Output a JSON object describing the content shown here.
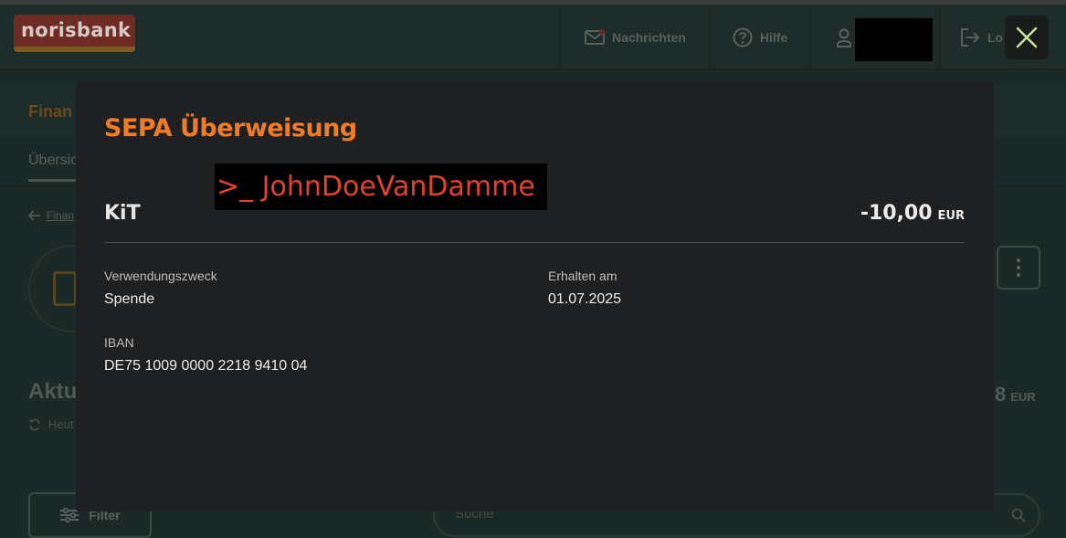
{
  "brand": {
    "logo_text": "norisbank"
  },
  "header": {
    "nav": [
      {
        "label": "Nachrichten",
        "icon": "mail-icon"
      },
      {
        "label": "Hilfe",
        "icon": "help-circle-icon"
      },
      {
        "label": "",
        "icon": "user-icon"
      },
      {
        "label": "Lo",
        "icon": "logout-icon"
      }
    ]
  },
  "background": {
    "section_title": "Finan",
    "tab_label": "Übersic",
    "back_link": "Finan",
    "balance_label": "Aktu",
    "updated_label": "Heut",
    "balance_value": "8",
    "balance_currency": "EUR",
    "filter_label": "Filter",
    "search_placeholder": "Suche"
  },
  "modal": {
    "title": "SEPA Überweisung",
    "overlay_text": ">_ JohnDoeVanDamme",
    "payee": "KiT",
    "amount": "-10,00",
    "currency": "EUR",
    "fields": {
      "purpose_label": "Verwendungszweck",
      "purpose_value": "Spende",
      "received_label": "Erhalten am",
      "received_value": "01.07.2025",
      "iban_label": "IBAN",
      "iban_value": "DE75 1009 0000 2218 9410 04"
    }
  },
  "colors": {
    "accent": "#f07c28",
    "overlay_text": "#e2432b",
    "modal_bg": "#1f2022",
    "page_bg": "#1c2a27",
    "close_icon": "#c9e59a"
  }
}
